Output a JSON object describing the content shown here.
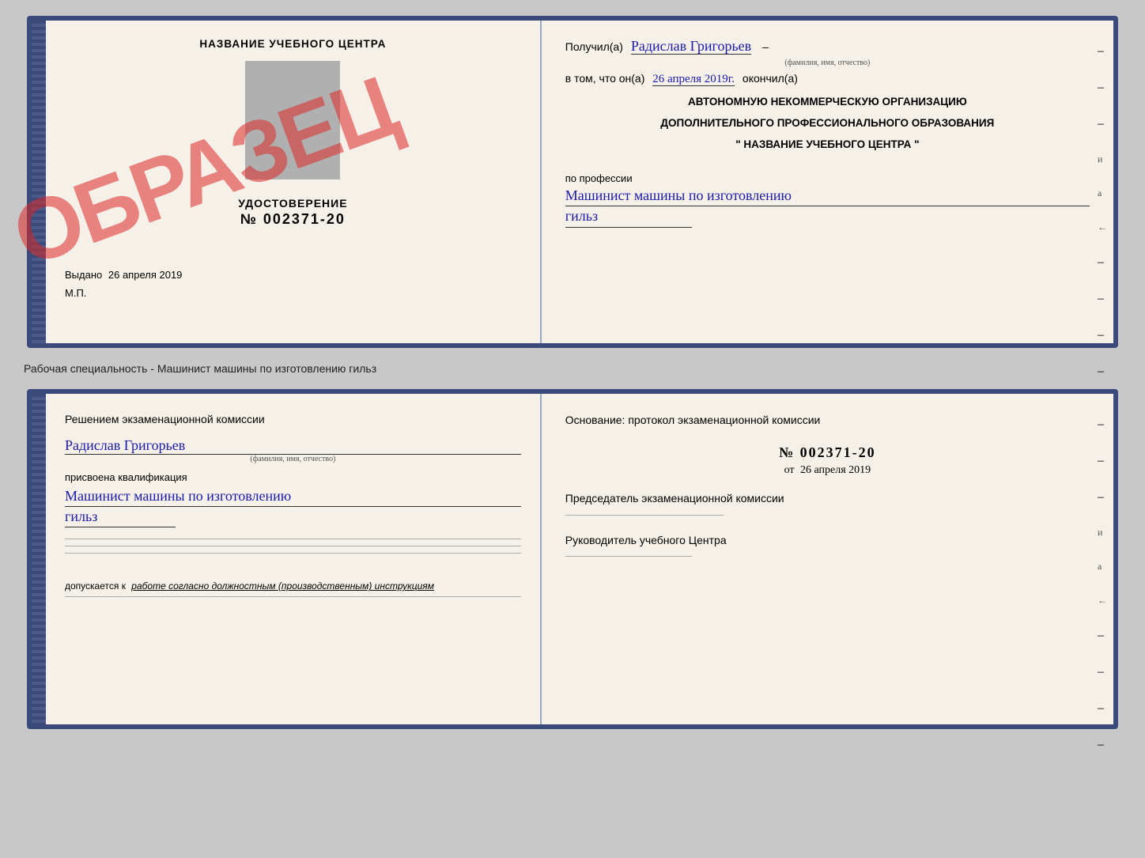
{
  "top_doc": {
    "left": {
      "center_title": "НАЗВАНИЕ УЧЕБНОГО ЦЕНТРА",
      "udostoverenie_label": "УДОСТОВЕРЕНИЕ",
      "udostoverenie_num": "№ 002371-20",
      "vydano": "Выдано",
      "vydano_date": "26 апреля 2019",
      "mp": "М.П.",
      "stamp": "ОБРАЗЕЦ"
    },
    "right": {
      "poluchil": "Получил(а)",
      "name_handwritten": "Радислав Григорьев",
      "fam_subtitle": "(фамилия, имя, отчество)",
      "vtom": "в том, что он(а)",
      "date_handwritten": "26 апреля 2019г.",
      "okonchil": "окончил(а)",
      "org_line1": "АВТОНОМНУЮ НЕКОММЕРЧЕСКУЮ ОРГАНИЗАЦИЮ",
      "org_line2": "ДОПОЛНИТЕЛЬНОГО ПРОФЕССИОНАЛЬНОГО ОБРАЗОВАНИЯ",
      "org_line3": "\"   НАЗВАНИЕ УЧЕБНОГО ЦЕНТРА   \"",
      "po_professii": "по профессии",
      "profession_handwritten1": "Машинист машины по изготовлению",
      "profession_handwritten2": "гильз"
    }
  },
  "separator": {
    "text": "Рабочая специальность - Машинист машины по изготовлению гильз"
  },
  "bottom_doc": {
    "left": {
      "title": "Решением  экзаменационной  комиссии",
      "name_handwritten": "Радислав Григорьев",
      "fam_subtitle": "(фамилия, имя, отчество)",
      "prisvoena": "присвоена квалификация",
      "qualification1": "Машинист машины по изготовлению",
      "qualification2": "гильз",
      "dopusk_label": "допускается к",
      "dopusk_text": "работе согласно должностным (производственным) инструкциям"
    },
    "right": {
      "osnovanie": "Основание: протокол экзаменационной  комиссии",
      "num": "№  002371-20",
      "ot": "от",
      "date": "26 апреля 2019",
      "pred_title": "Председатель экзаменационной комиссии",
      "ruk_title": "Руководитель учебного Центра"
    }
  }
}
